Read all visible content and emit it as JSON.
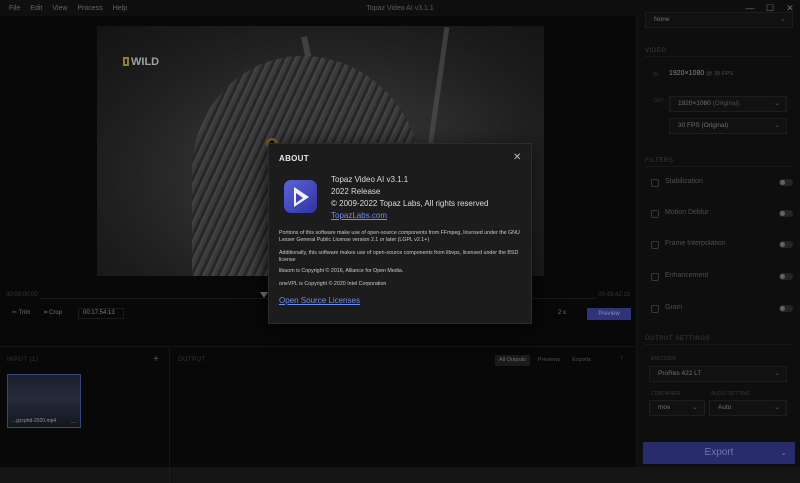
{
  "window": {
    "title": "Topaz Video AI  v3.1.1"
  },
  "menu": [
    "File",
    "Edit",
    "View",
    "Process",
    "Help"
  ],
  "window_controls": {
    "minimize": "—",
    "maximize": "☐",
    "close": "✕"
  },
  "video": {
    "watermark_text": "WILD"
  },
  "timeline": {
    "start": "00:00:00:00",
    "end": "00:43:42:13"
  },
  "controls": {
    "trim": "Trim",
    "crop": "Crop",
    "timecode": "00:17:54:13",
    "zoom": "2 x",
    "preview": "Preview"
  },
  "input_panel": {
    "label": "INPUT (1)",
    "add": "+",
    "file_name": "...gzcphd-2020.mp4",
    "more": "..."
  },
  "output_panel": {
    "label": "OUTPUT",
    "tabs": [
      "All Outputs",
      "Previews",
      "Exports"
    ],
    "collapse": "↑"
  },
  "right_panel": {
    "top_select": "None",
    "video_header": "VIDEO",
    "in_tag": "IN",
    "input_info_res": "1920×1080",
    "input_info_fps": "@ 30 FPS",
    "out_tag": "OUT",
    "resolution": "1920×1080",
    "resolution_suffix": "(Original)",
    "fps": "30 FPS (Original)",
    "filters_header": "FILTERS",
    "filters": [
      "Stabilization",
      "Motion Deblur",
      "Frame Interpolation",
      "Enhancement",
      "Grain"
    ],
    "output_header": "OUTPUT SETTINGS",
    "encoder_label": "ENCODER",
    "encoder": "ProRes 422 LT",
    "container_label": "CONTAINER",
    "container": "mov",
    "audio_label": "AUDIO SETTING",
    "audio": "Auto",
    "export": "Export"
  },
  "about": {
    "title": "ABOUT",
    "close": "✕",
    "app_name": "Topaz Video AI  v3.1.1",
    "release": "2022 Release",
    "copyright": "© 2009-2022 Topaz Labs, All rights reserved",
    "link": "TopazLabs.com",
    "p1": "Portions of this software make use of open-source components from FFmpeg, licensed under the GNU Lesser General Public License version 2.1 or later (LGPL v2.1+)",
    "p2": "Additionally, this software makes use of open-source components from libvpx, licensed under the BSD license",
    "p3": "libaom is Copyright © 2016, Alliance for Open Media.",
    "p4": "oneVPL is Copyright © 2020 Intel Corporation",
    "licenses_link": "Open Source Licenses"
  }
}
